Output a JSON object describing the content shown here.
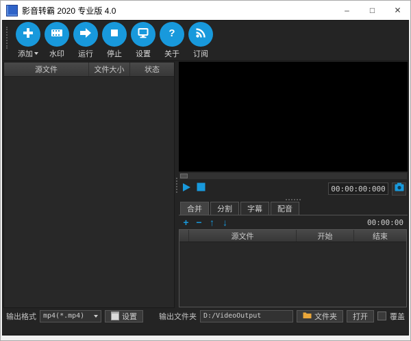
{
  "window": {
    "title": "影音转霸 2020 专业版 4.0",
    "controls": [
      {
        "name": "minimize",
        "glyph": "–"
      },
      {
        "name": "maximize",
        "glyph": "□"
      },
      {
        "name": "close",
        "glyph": "✕"
      }
    ]
  },
  "toolbar": {
    "items": [
      {
        "label": "添加",
        "icon": "plus-icon",
        "dropdown": true
      },
      {
        "label": "水印",
        "icon": "film-icon"
      },
      {
        "label": "运行",
        "icon": "run-arrow-icon"
      },
      {
        "label": "停止",
        "icon": "stop-icon"
      },
      {
        "label": "设置",
        "icon": "monitor-icon"
      },
      {
        "label": "关于",
        "icon": "question-icon"
      },
      {
        "label": "订阅",
        "icon": "rss-icon"
      }
    ]
  },
  "file_list": {
    "columns": [
      "源文件",
      "文件大小",
      "状态"
    ],
    "rows": []
  },
  "player": {
    "time": "00:00:00:000",
    "play_icon": "play-icon",
    "stop_icon": "stop-icon",
    "snapshot_icon": "snapshot-icon"
  },
  "clip_panel": {
    "tabs": [
      {
        "label": "合并",
        "active": true
      },
      {
        "label": "分割",
        "active": false
      },
      {
        "label": "字幕",
        "active": false
      },
      {
        "label": "配音",
        "active": false
      }
    ],
    "buttons": [
      {
        "icon": "add-clip-icon",
        "glyph": "+"
      },
      {
        "icon": "remove-clip-icon",
        "glyph": "−"
      },
      {
        "icon": "move-up-icon",
        "glyph": "↑"
      },
      {
        "icon": "move-down-icon",
        "glyph": "↓"
      }
    ],
    "duration": "00:00:00",
    "columns": [
      "",
      "源文件",
      "开始",
      "结束"
    ],
    "rows": []
  },
  "output": {
    "format_label": "输出格式",
    "format_value": "mp4(*.mp4)",
    "settings_button": "设置",
    "folder_label": "输出文件夹",
    "folder_path": "D:/VideoOutput",
    "folder_button": "文件夹",
    "open_button": "打开",
    "overwrite_label": "覆盖"
  },
  "colors": {
    "accent": "#1899dc",
    "folder_icon": "#e9a63a",
    "titlebar_bg": "#ffffff",
    "panel_bg": "#282828"
  }
}
